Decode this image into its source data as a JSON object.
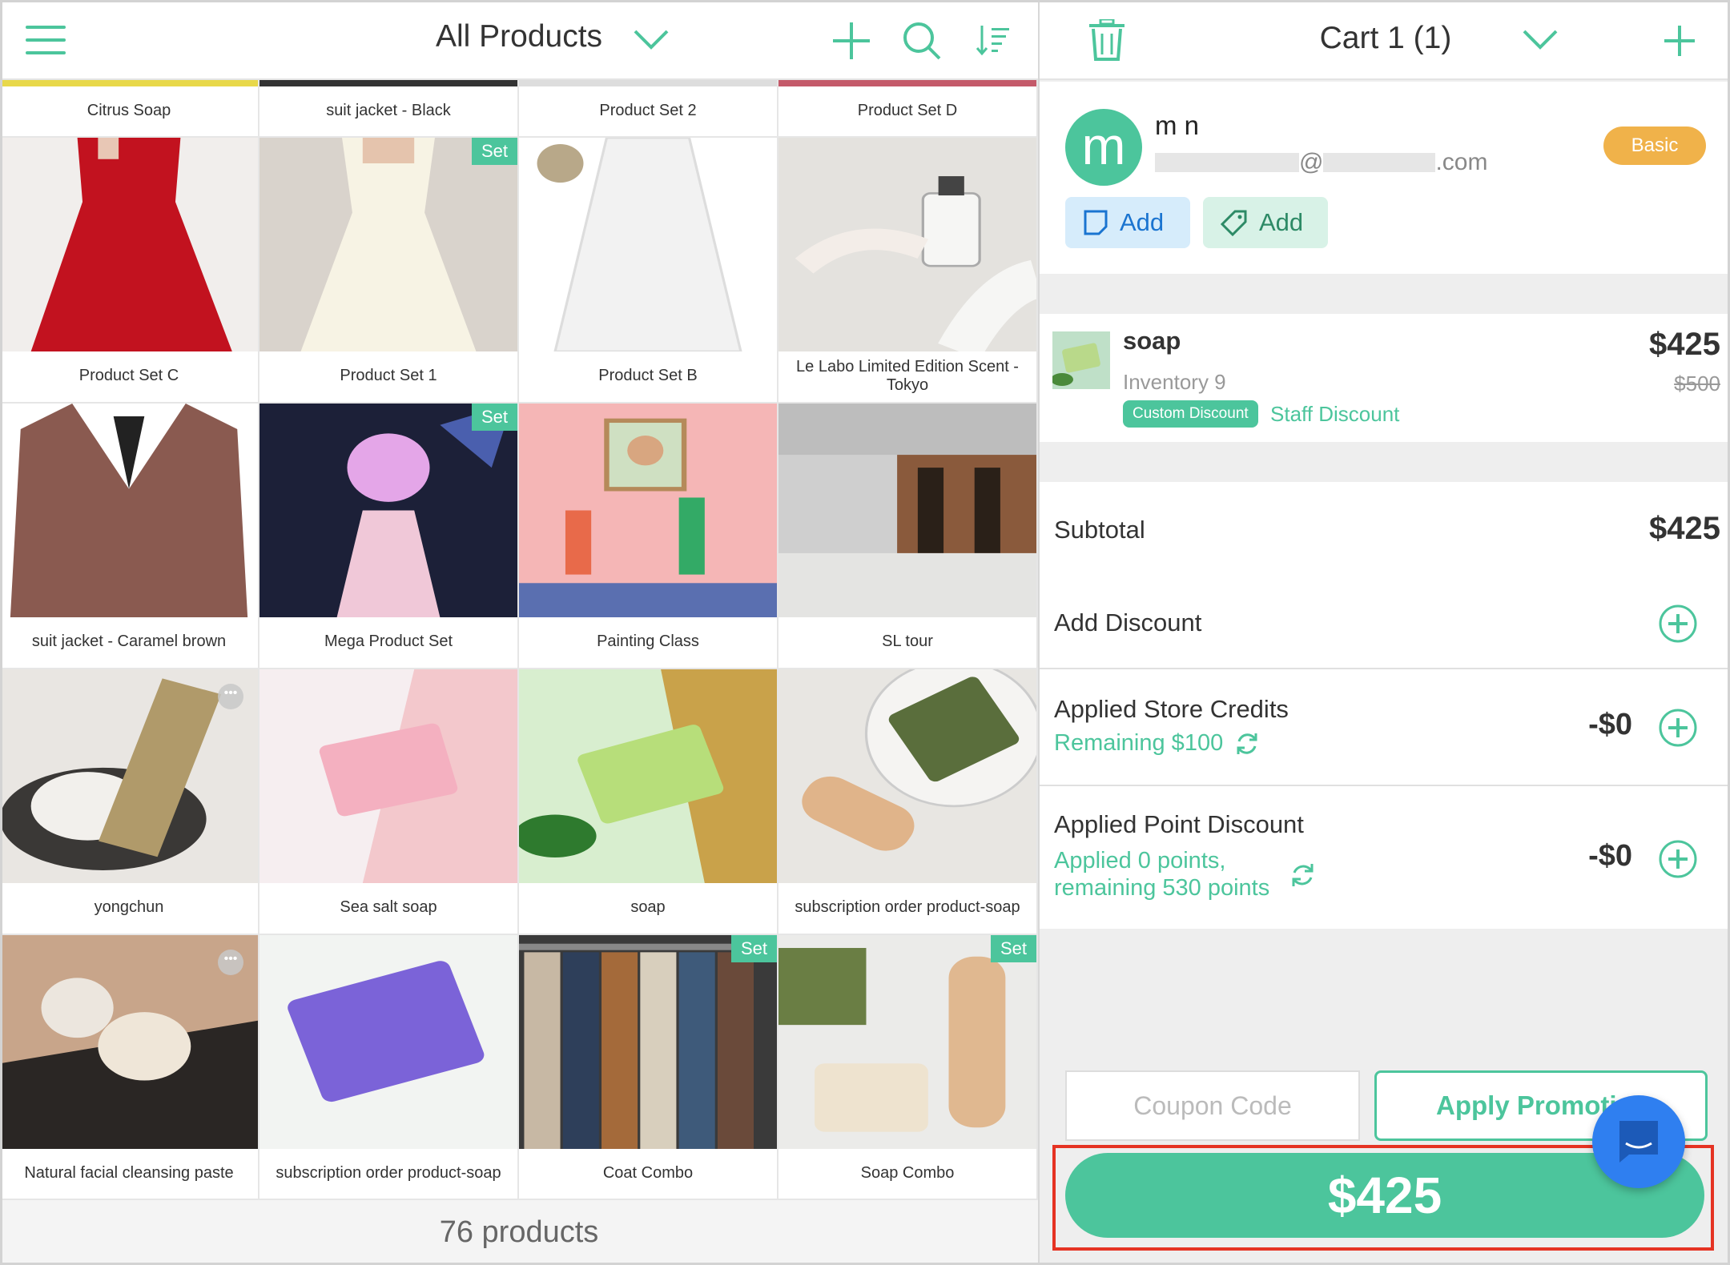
{
  "left": {
    "title": "All Products",
    "footer": "76 products",
    "top_row": [
      "Citrus Soap",
      "suit jacket - Black",
      "Product Set 2",
      "Product Set D"
    ],
    "products": [
      {
        "name": "Product Set C",
        "badge": "",
        "dots": false,
        "img": "red-dress"
      },
      {
        "name": "Product Set 1",
        "badge": "Set",
        "dots": false,
        "img": "white-dress"
      },
      {
        "name": "Product Set B",
        "badge": "",
        "dots": false,
        "img": "white-skirt"
      },
      {
        "name": "Le Labo Limited Edition Scent - Tokyo",
        "badge": "",
        "dots": false,
        "img": "perfume"
      },
      {
        "name": "suit jacket - Caramel brown",
        "badge": "",
        "dots": false,
        "img": "jacket"
      },
      {
        "name": "Mega Product Set",
        "badge": "Set",
        "dots": false,
        "img": "anime"
      },
      {
        "name": "Painting Class",
        "badge": "",
        "dots": false,
        "img": "painting"
      },
      {
        "name": "SL tour",
        "badge": "",
        "dots": false,
        "img": "hall"
      },
      {
        "name": "yongchun",
        "badge": "",
        "dots": true,
        "img": "cat"
      },
      {
        "name": "Sea salt soap",
        "badge": "",
        "dots": false,
        "img": "pink-soap"
      },
      {
        "name": "soap",
        "badge": "",
        "dots": false,
        "img": "green-soap"
      },
      {
        "name": "subscription order product-soap",
        "badge": "",
        "dots": false,
        "img": "olive-soap"
      },
      {
        "name": "Natural facial cleansing paste",
        "badge": "",
        "dots": true,
        "img": "cream"
      },
      {
        "name": "subscription order product-soap",
        "badge": "",
        "dots": false,
        "img": "purple-soap"
      },
      {
        "name": "Coat Combo",
        "badge": "Set",
        "dots": false,
        "img": "coats"
      },
      {
        "name": "Soap Combo",
        "badge": "Set",
        "dots": false,
        "img": "soap-combo"
      }
    ]
  },
  "cart": {
    "title": "Cart 1 (1)",
    "customer": {
      "initial": "m",
      "name": "m n",
      "email_at": "@",
      "email_domain_end": ".com",
      "tier": "Basic",
      "note_btn": "Add",
      "tag_btn": "Add"
    },
    "item": {
      "name": "soap",
      "inventory": "Inventory 9",
      "price": "$425",
      "original_price": "$500",
      "discount_tag": "Custom Discount",
      "discount_name": "Staff Discount"
    },
    "subtotal_label": "Subtotal",
    "subtotal_value": "$425",
    "add_discount_label": "Add Discount",
    "store_credits_label": "Applied Store Credits",
    "store_credits_remaining": "Remaining $100",
    "store_credits_value": "-$0",
    "points_label": "Applied Point Discount",
    "points_line1": "Applied 0 points,",
    "points_line2": "remaining 530 points",
    "points_value": "-$0",
    "coupon_placeholder": "Coupon Code",
    "apply_label": "Apply Promotion",
    "pay_label": "$425"
  },
  "colors": {
    "accent": "#4cc59c",
    "tier": "#f0b24a",
    "highlight": "#e53323",
    "chat": "#2f7ff0"
  }
}
